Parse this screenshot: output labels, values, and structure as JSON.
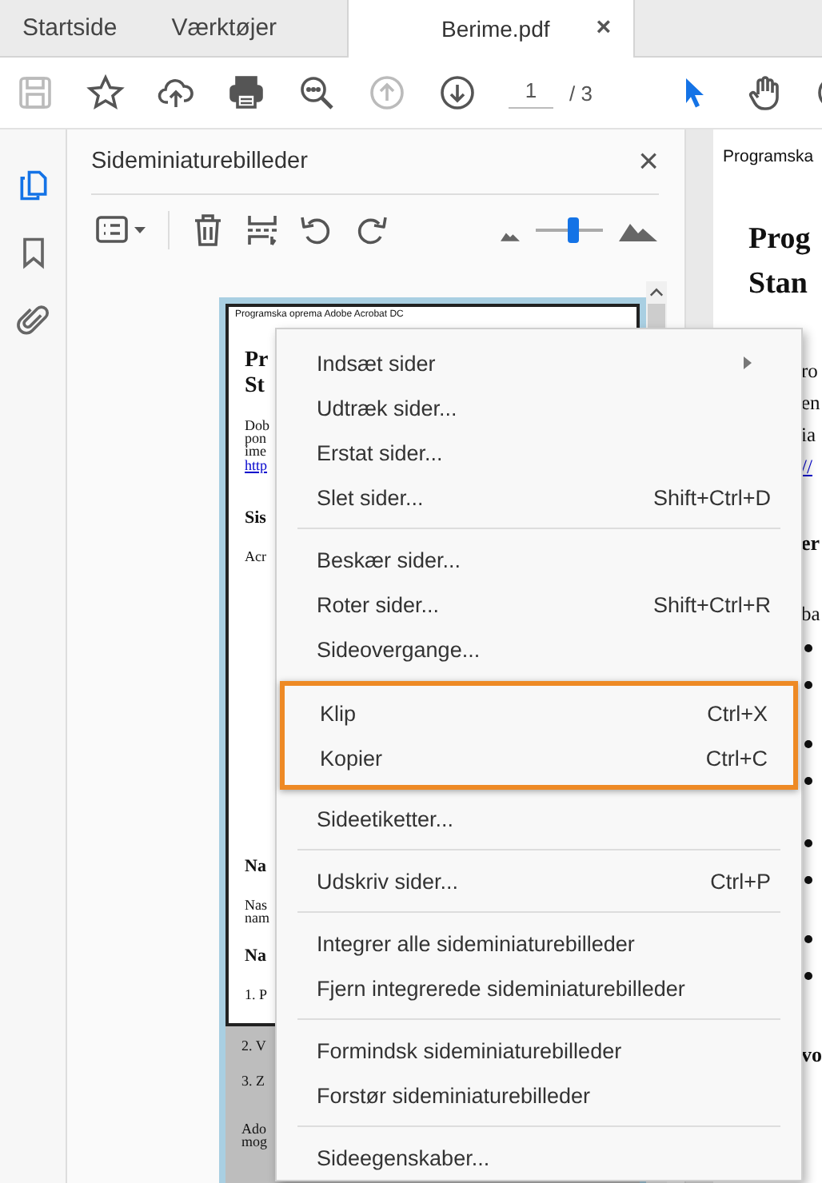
{
  "tabs": [
    {
      "label": "Startside",
      "selected": false
    },
    {
      "label": "Værktøjer",
      "selected": false
    },
    {
      "label": "Berime.pdf",
      "selected": true,
      "close": "×"
    }
  ],
  "toolbar": {
    "tools": [
      {
        "kind": "save",
        "disabled": true
      },
      {
        "kind": "star",
        "disabled": false
      },
      {
        "kind": "upload",
        "disabled": false
      },
      {
        "kind": "print",
        "disabled": false
      },
      {
        "kind": "zoom",
        "disabled": false
      },
      {
        "kind": "prev",
        "disabled": true
      },
      {
        "kind": "next",
        "disabled": false
      }
    ],
    "page_current": "1",
    "page_total": "/ 3",
    "modes": [
      {
        "kind": "pointer",
        "selected": true
      },
      {
        "kind": "hand",
        "selected": false
      },
      {
        "kind": "zoomout",
        "selected": false
      }
    ]
  },
  "rail": [
    {
      "kind": "pages",
      "selected": true
    },
    {
      "kind": "bookmark",
      "selected": false
    },
    {
      "kind": "attachment",
      "selected": false
    }
  ],
  "panel": {
    "title": "Sideminiaturebilleder",
    "close": "×",
    "tools": [
      {
        "kind": "options"
      },
      {
        "kind": "delete"
      },
      {
        "kind": "extract"
      },
      {
        "kind": "rotate_left"
      },
      {
        "kind": "rotate_right"
      }
    ],
    "thumb_size": {
      "level": 0.55
    }
  },
  "thumbnail": {
    "header": "Programska oprema Adobe Acrobat DC",
    "top_blocks": [
      {
        "kind": "heading",
        "lines": [
          "Pr",
          "St"
        ]
      },
      {
        "kind": "body",
        "lines": [
          "Dob",
          "pon",
          "ime"
        ]
      },
      {
        "kind": "link",
        "lines": [
          "http"
        ]
      },
      {
        "kind": "subheading",
        "lines": [
          "Sis"
        ]
      },
      {
        "kind": "body",
        "lines": [
          "Acr"
        ]
      }
    ],
    "bottom_blocks": [
      {
        "kind": "subheading",
        "lines": [
          "Na"
        ]
      },
      {
        "kind": "body",
        "lines": [
          "Nas",
          "nam"
        ]
      },
      {
        "kind": "subheading",
        "lines": [
          "Na"
        ]
      },
      {
        "kind": "body",
        "lines": [
          "1. P"
        ]
      }
    ],
    "shaded_blocks": [
      {
        "kind": "body",
        "lines": [
          "2. V"
        ]
      },
      {
        "kind": "body",
        "lines": [
          "3. Z"
        ]
      },
      {
        "kind": "body",
        "lines": [
          "Ado",
          "mog"
        ]
      }
    ]
  },
  "document": {
    "header": "Programska",
    "title": [
      "Prog",
      "Stan"
    ],
    "lines": [
      {
        "kind": "text",
        "text": "ro"
      },
      {
        "kind": "text",
        "text": "en"
      },
      {
        "kind": "text",
        "text": "ia"
      },
      {
        "kind": "link",
        "text": "//"
      },
      {
        "kind": "subheading",
        "text": "er"
      },
      {
        "kind": "text",
        "text": "ba"
      },
      {
        "kind": "bullet"
      },
      {
        "kind": "bullet"
      },
      {
        "kind": "bullet"
      },
      {
        "kind": "bullet"
      },
      {
        "kind": "bullet"
      },
      {
        "kind": "bullet"
      },
      {
        "kind": "bullet"
      },
      {
        "kind": "bullet"
      },
      {
        "kind": "subheading",
        "text": "vo"
      }
    ]
  },
  "context_menu": {
    "items": [
      {
        "kind": "item",
        "label": "Indsæt sider",
        "submenu": true
      },
      {
        "kind": "item",
        "label": "Udtræk sider..."
      },
      {
        "kind": "item",
        "label": "Erstat sider..."
      },
      {
        "kind": "item",
        "label": "Slet sider...",
        "shortcut": "Shift+Ctrl+D"
      },
      {
        "kind": "separator"
      },
      {
        "kind": "item",
        "label": "Beskær sider..."
      },
      {
        "kind": "item",
        "label": "Roter sider...",
        "shortcut": "Shift+Ctrl+R"
      },
      {
        "kind": "item",
        "label": "Sideovergange..."
      },
      {
        "kind": "highlight",
        "items": [
          {
            "kind": "item",
            "label": "Klip",
            "shortcut": "Ctrl+X"
          },
          {
            "kind": "item",
            "label": "Kopier",
            "shortcut": "Ctrl+C"
          }
        ]
      },
      {
        "kind": "item",
        "label": "Sideetiketter..."
      },
      {
        "kind": "separator"
      },
      {
        "kind": "item",
        "label": "Udskriv sider...",
        "shortcut": "Ctrl+P"
      },
      {
        "kind": "separator"
      },
      {
        "kind": "item",
        "label": "Integrer alle sideminiaturebilleder"
      },
      {
        "kind": "item",
        "label": "Fjern integrerede sideminiaturebilleder"
      },
      {
        "kind": "separator"
      },
      {
        "kind": "item",
        "label": "Formindsk sideminiaturebilleder"
      },
      {
        "kind": "item",
        "label": "Forstør sideminiaturebilleder"
      },
      {
        "kind": "separator"
      },
      {
        "kind": "item",
        "label": "Sideegenskaber..."
      }
    ]
  }
}
